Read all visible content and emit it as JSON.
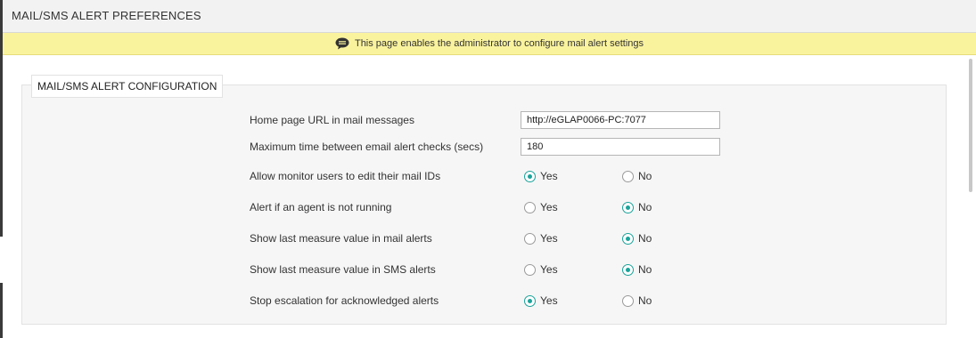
{
  "header": {
    "title": "MAIL/SMS ALERT PREFERENCES"
  },
  "info_bar": {
    "icon": "speech-bubble-icon",
    "text": "This page enables the administrator to configure mail alert settings"
  },
  "config": {
    "legend": "MAIL/SMS ALERT CONFIGURATION",
    "fields": {
      "home_url": {
        "label": "Home page URL in mail messages",
        "value": "http://eGLAP0066-PC:7077"
      },
      "max_time": {
        "label": "Maximum time between email alert checks (secs)",
        "value": "180"
      }
    },
    "options": {
      "yes_label": "Yes",
      "no_label": "No"
    },
    "radios": [
      {
        "label": "Allow monitor users to edit their mail IDs",
        "selected": "Yes"
      },
      {
        "label": "Alert if an agent is not running",
        "selected": "No"
      },
      {
        "label": "Show last measure value in mail alerts",
        "selected": "No"
      },
      {
        "label": "Show last measure value in SMS alerts",
        "selected": "No"
      },
      {
        "label": "Stop escalation for acknowledged alerts",
        "selected": "Yes"
      }
    ]
  },
  "colors": {
    "accent": "#1aa39a",
    "info_bar_bg": "#faf39e",
    "header_bg": "#f2f2f2"
  }
}
